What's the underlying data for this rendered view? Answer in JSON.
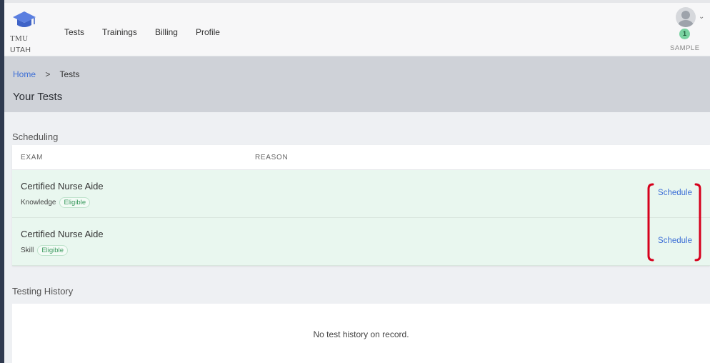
{
  "brand": {
    "logo_text": "TMU",
    "logo_sub": "UTAH"
  },
  "nav": {
    "items": [
      "Tests",
      "Trainings",
      "Billing",
      "Profile"
    ]
  },
  "user": {
    "badge": "1",
    "name": "SAMPLE",
    "menu_icon": "chevron-down-icon"
  },
  "breadcrumb": {
    "home": "Home",
    "separator": ">",
    "current": "Tests"
  },
  "page_title": "Your Tests",
  "scheduling": {
    "title": "Scheduling",
    "columns": [
      "EXAM",
      "REASON"
    ],
    "rows": [
      {
        "exam": "Certified Nurse Aide",
        "type": "Knowledge",
        "status": "Eligible",
        "action": "Schedule"
      },
      {
        "exam": "Certified Nurse Aide",
        "type": "Skill",
        "status": "Eligible",
        "action": "Schedule"
      }
    ]
  },
  "history": {
    "title": "Testing History",
    "empty": "No test history on record."
  },
  "colors": {
    "accent": "#3d6fd6",
    "eligible": "#3a9a5e",
    "row_bg": "#e9f7ef",
    "highlight": "#d6001c"
  }
}
